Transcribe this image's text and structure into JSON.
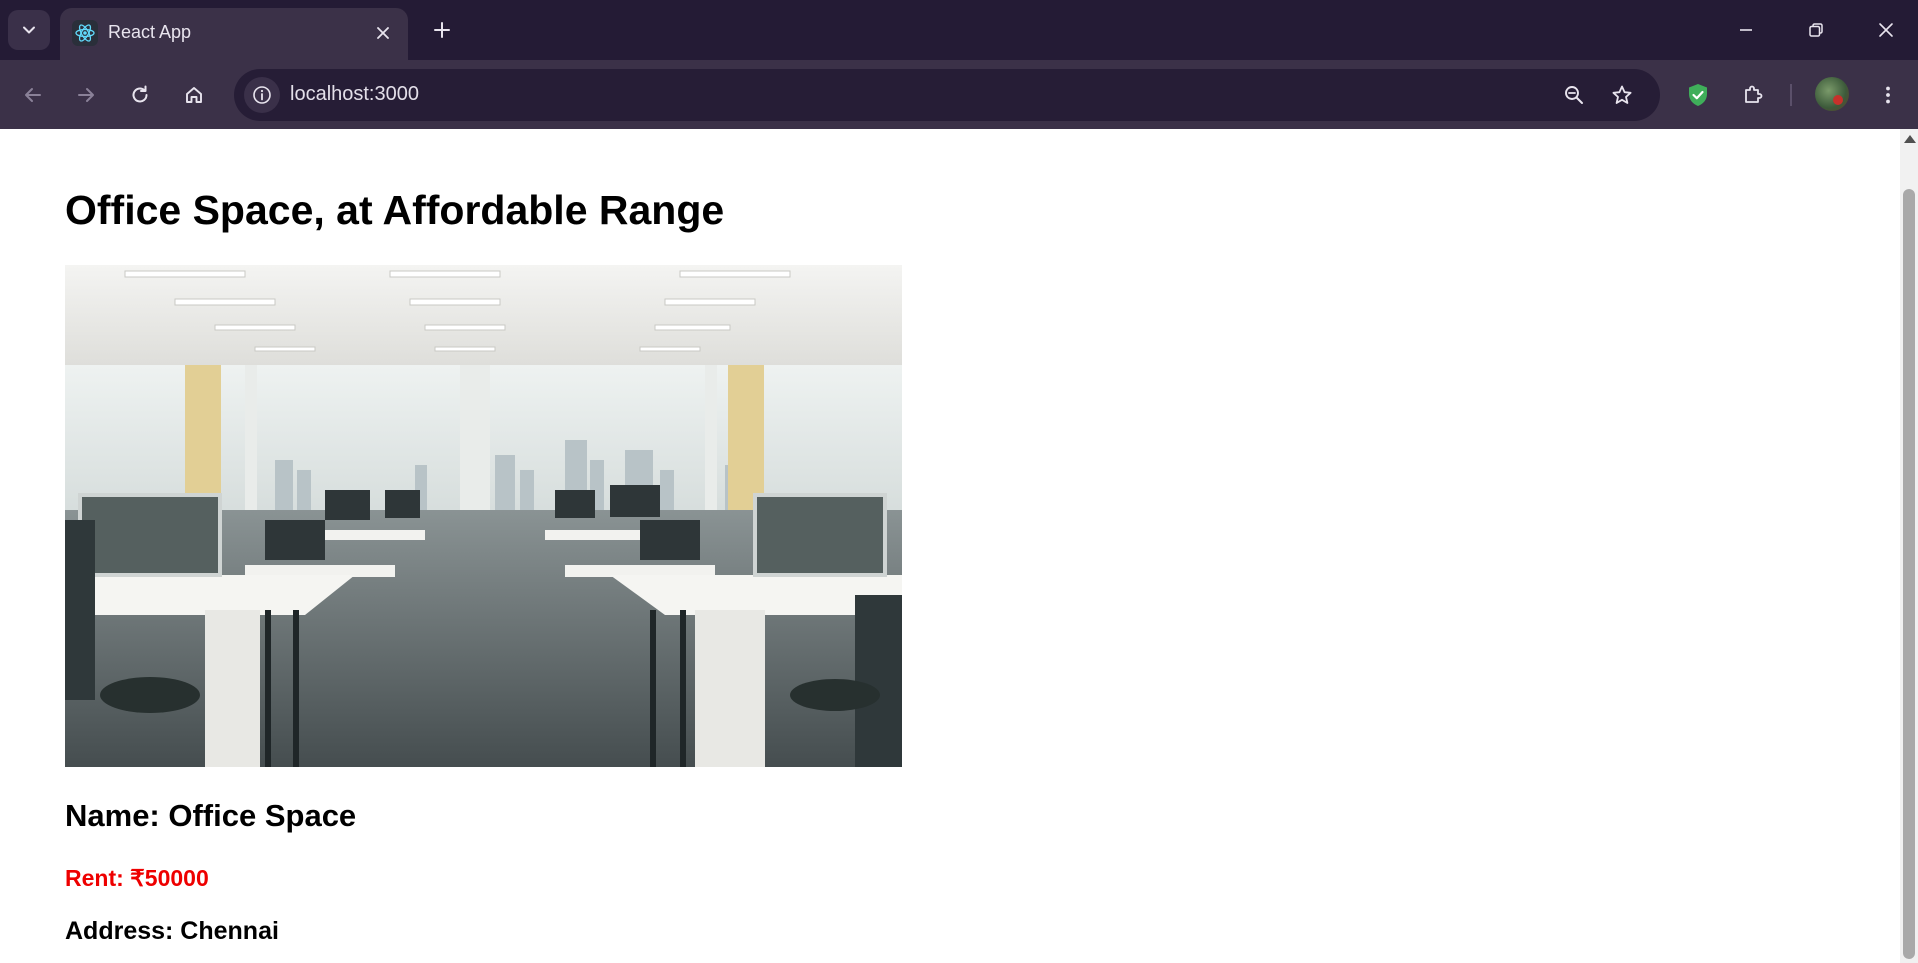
{
  "browser": {
    "tab_title": "React App",
    "url": "localhost:3000",
    "icons": {
      "tab_search": "chevron-down-icon",
      "favicon": "react-atom-icon",
      "tab_close": "close-icon",
      "new_tab": "plus-icon",
      "minimize": "minimize-icon",
      "restore": "restore-icon",
      "close_window": "close-icon",
      "back": "arrow-left-icon",
      "forward": "arrow-right-icon",
      "reload": "reload-icon",
      "home": "home-icon",
      "site_info": "info-icon",
      "zoom": "zoom-out-icon",
      "bookmark": "star-icon",
      "shield_extension": "shield-check-icon",
      "extensions": "puzzle-icon",
      "profile": "avatar",
      "menu": "kebab-menu-icon"
    },
    "colors": {
      "frame": "#241b35",
      "toolbar": "#3b3148",
      "omnibox": "#261d36",
      "shield_green": "#3fae5a"
    }
  },
  "page": {
    "title": "Office Space, at Affordable Range",
    "image_subject": "open-plan office with white desks, monitors and city-view windows",
    "name_line": "Name: Office Space",
    "rent_line": "Rent: ₹50000",
    "address_line": "Address: Chennai",
    "colors": {
      "rent": "#ee0000",
      "text": "#000000",
      "background": "#ffffff"
    }
  }
}
